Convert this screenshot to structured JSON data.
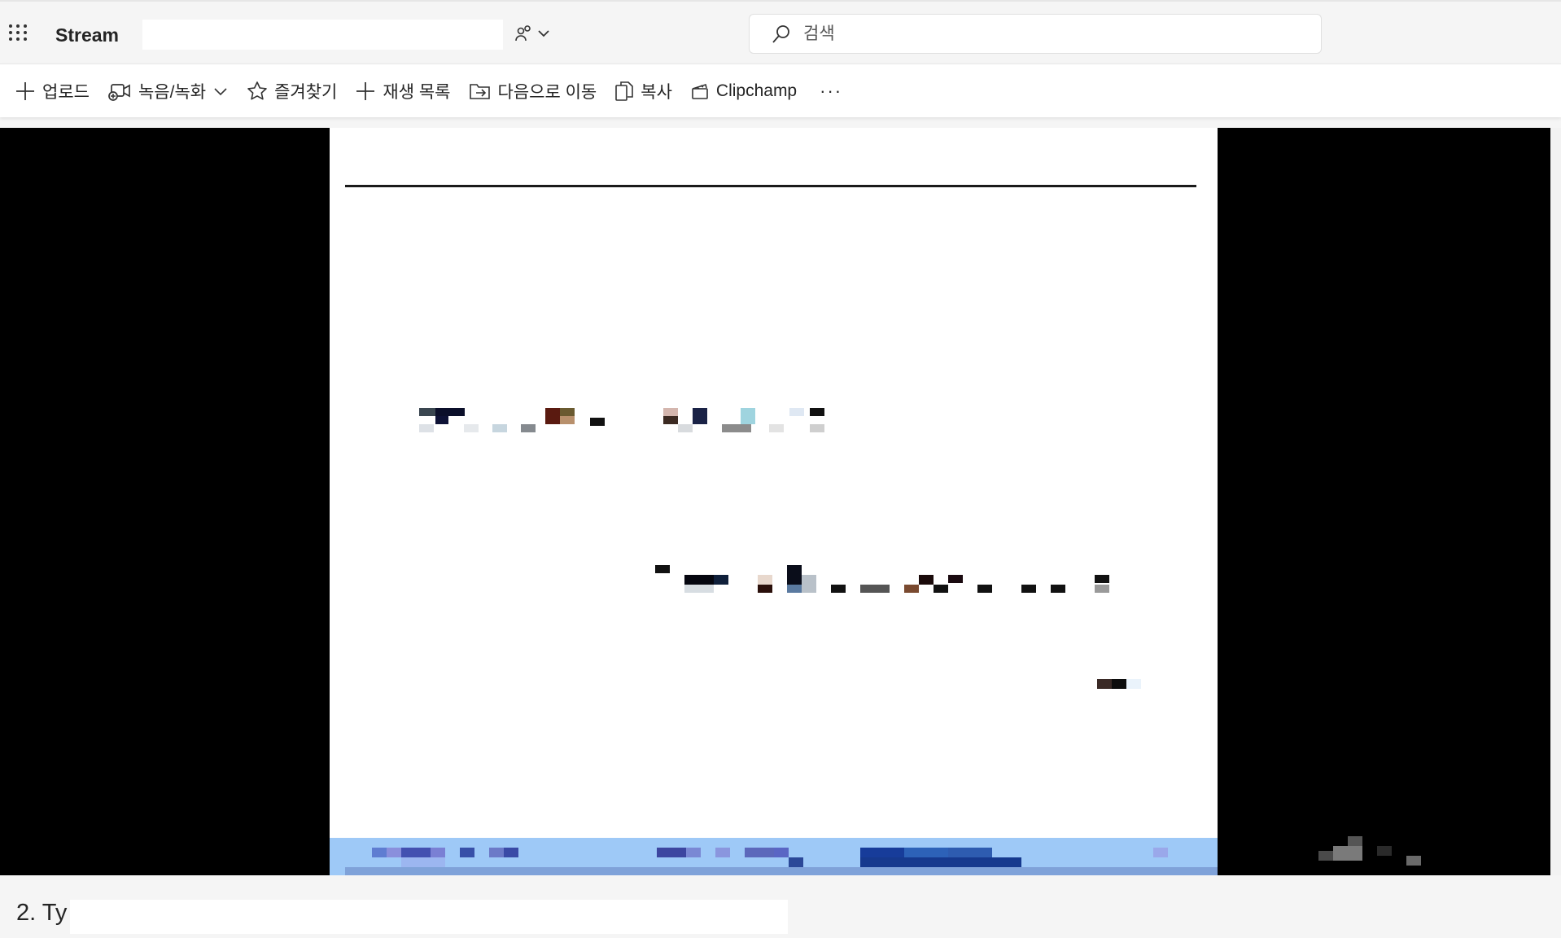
{
  "app": {
    "name": "Stream"
  },
  "header": {
    "title_value": "",
    "share_icon": "people-share-icon",
    "search_placeholder": "검색"
  },
  "toolbar": {
    "upload": "업로드",
    "record": "녹음/녹화",
    "favorite": "즐겨찾기",
    "playlist": "재생 목록",
    "move_to": "다음으로 이동",
    "copy": "복사",
    "clipchamp": "Clipchamp",
    "more": "···"
  },
  "video": {
    "background_color": "#000000",
    "slide_color": "#ffffff",
    "footer_color": "#9ec9f7"
  },
  "caption": {
    "title_prefix": "2. Ty",
    "title_input_value": ""
  }
}
